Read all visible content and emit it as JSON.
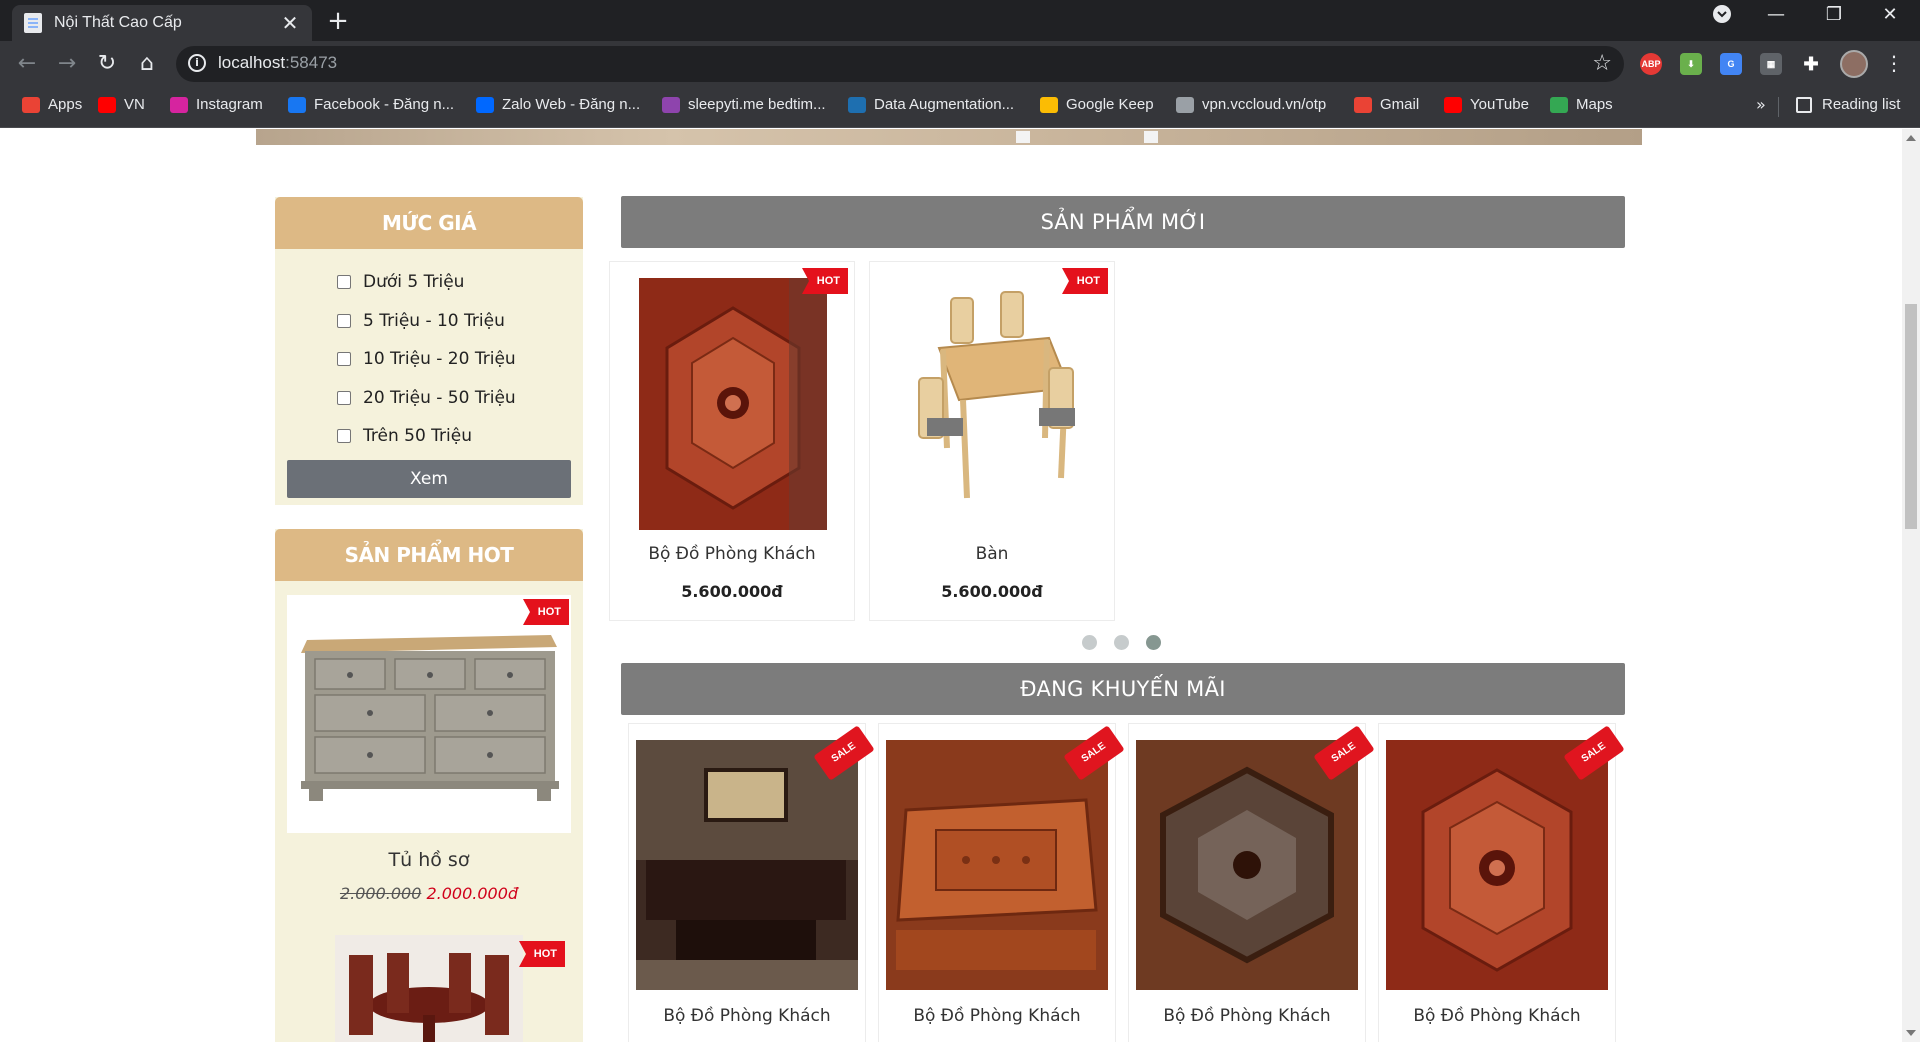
{
  "browser": {
    "tab_title": "Nội Thất Cao Cấp",
    "url_host": "localhost",
    "url_port": ":58473",
    "bookmarks": [
      {
        "label": "Apps",
        "icon": "apps-grid-icon",
        "color": "#ea4335"
      },
      {
        "label": "VN",
        "icon": "youtube-icon",
        "color": "#ff0000"
      },
      {
        "label": "Instagram",
        "icon": "instagram-icon",
        "color": "#d6249f"
      },
      {
        "label": "Facebook - Đăng n...",
        "icon": "facebook-icon",
        "color": "#1877f2"
      },
      {
        "label": "Zalo Web - Đăng n...",
        "icon": "zalo-icon",
        "color": "#0068ff"
      },
      {
        "label": "sleepyti.me bedtim...",
        "icon": "sleepytime-icon",
        "color": "#8e44ad"
      },
      {
        "label": "Data Augmentation...",
        "icon": "document-icon",
        "color": "#1e6fb0"
      },
      {
        "label": "Google Keep",
        "icon": "google-keep-icon",
        "color": "#fbbc04"
      },
      {
        "label": "vpn.vccloud.vn/otp",
        "icon": "globe-icon",
        "color": "#9aa0a6"
      },
      {
        "label": "Gmail",
        "icon": "gmail-icon",
        "color": "#ea4335"
      },
      {
        "label": "YouTube",
        "icon": "youtube-icon",
        "color": "#ff0000"
      },
      {
        "label": "Maps",
        "icon": "google-maps-icon",
        "color": "#34a853"
      }
    ],
    "more_bookmarks": "»",
    "reading_list": "Reading list"
  },
  "sidebar": {
    "price_title": "MỨC GIÁ",
    "price_options": [
      "Dưới 5 Triệu",
      "5 Triệu - 10 Triệu",
      "10 Triệu - 20 Triệu",
      "20 Triệu - 50 Triệu",
      "Trên 50 Triệu"
    ],
    "view_button": "Xem",
    "hot_title": "SẢN PHẨM HOT",
    "hot_products": [
      {
        "name": "Tủ hồ sơ",
        "old_price": "2.000.000",
        "price": "2.000.000đ",
        "badge": "HOT"
      },
      {
        "name": "",
        "badge": "HOT"
      }
    ]
  },
  "new_products": {
    "title": "SẢN PHẨM MỚI",
    "items": [
      {
        "name": "Bộ Đồ Phòng Khách",
        "price": "5.600.000đ",
        "badge": "HOT"
      },
      {
        "name": "Bàn",
        "price": "5.600.000đ",
        "badge": "HOT"
      }
    ],
    "carousel_pages": 3,
    "active_page": 3
  },
  "promotions": {
    "title": "ĐANG KHUYẾN MÃI",
    "items": [
      {
        "name": "Bộ Đồ Phòng Khách",
        "badge": "SALE"
      },
      {
        "name": "Bộ Đồ Phòng Khách",
        "badge": "SALE"
      },
      {
        "name": "Bộ Đồ Phòng Khách",
        "badge": "SALE"
      },
      {
        "name": "Bộ Đồ Phòng Khách",
        "badge": "SALE"
      }
    ]
  },
  "colors": {
    "accent_tan": "#ddb985",
    "sidebar_bg": "#f5f2dc",
    "section_bar": "#7c7c7c",
    "hot_red": "#e4111c",
    "price_red": "#d0021b"
  }
}
